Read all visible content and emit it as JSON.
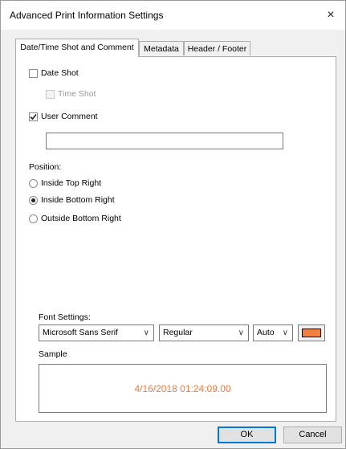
{
  "window": {
    "title": "Advanced Print Information Settings",
    "close_icon": "×"
  },
  "tabs": [
    {
      "label": "Date/Time Shot and Comment",
      "active": true
    },
    {
      "label": "Metadata",
      "active": false
    },
    {
      "label": "Header / Footer",
      "active": false
    }
  ],
  "date_time": {
    "date_shot": {
      "label": "Date Shot",
      "checked": false
    },
    "time_shot": {
      "label": "Time Shot",
      "checked": false,
      "enabled": false
    },
    "user_comment": {
      "label": "User Comment",
      "checked": true,
      "value": ""
    }
  },
  "position": {
    "label": "Position:",
    "options": [
      {
        "label": "Inside Top Right",
        "selected": false
      },
      {
        "label": "Inside Bottom Right",
        "selected": true
      },
      {
        "label": "Outside Bottom Right",
        "selected": false
      }
    ]
  },
  "font_settings": {
    "label": "Font Settings:",
    "font_family": "Microsoft Sans Serif",
    "font_style": "Regular",
    "font_size": "Auto",
    "color": "#f08040",
    "chevron_icon": "∨"
  },
  "sample": {
    "label": "Sample",
    "text": "4/16/2018 01:24:09.00",
    "text_color": "#f07a3c"
  },
  "buttons": {
    "ok": "OK",
    "cancel": "Cancel"
  }
}
